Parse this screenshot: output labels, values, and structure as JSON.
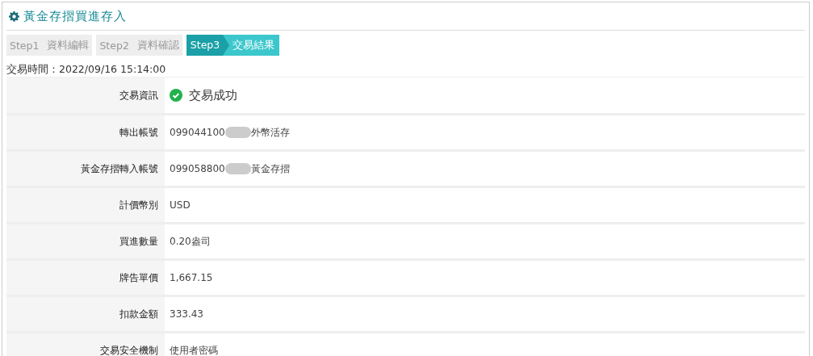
{
  "title": "黃金存摺買進存入",
  "steps": [
    {
      "step": "Step1",
      "label": "資料編輯",
      "selected": false
    },
    {
      "step": "Step2",
      "label": "資料確認",
      "selected": false
    },
    {
      "step": "Step3",
      "label": "交易結果",
      "selected": true
    }
  ],
  "time": "交易時間：2022/09/16 15:14:00",
  "rows": [
    {
      "kind": "status",
      "label": "交易資訊",
      "value": "交易成功"
    },
    {
      "kind": "account",
      "label": "轉出帳號",
      "value": "099044100",
      "redacted": true,
      "suffix": "外幣活存"
    },
    {
      "kind": "account",
      "label": "黃金存摺轉入帳號",
      "value": "099058800",
      "redacted": true,
      "suffix": "黃金存摺"
    },
    {
      "kind": "text",
      "label": "計價幣別",
      "value": "USD"
    },
    {
      "kind": "text",
      "label": "買進數量",
      "value": "0.20盎司"
    },
    {
      "kind": "text",
      "label": "牌告單價",
      "value": "1,667.15"
    },
    {
      "kind": "text",
      "label": "扣款金額",
      "value": "333.43"
    },
    {
      "kind": "text",
      "label": "交易安全機制",
      "value": "使用者密碼"
    }
  ]
}
